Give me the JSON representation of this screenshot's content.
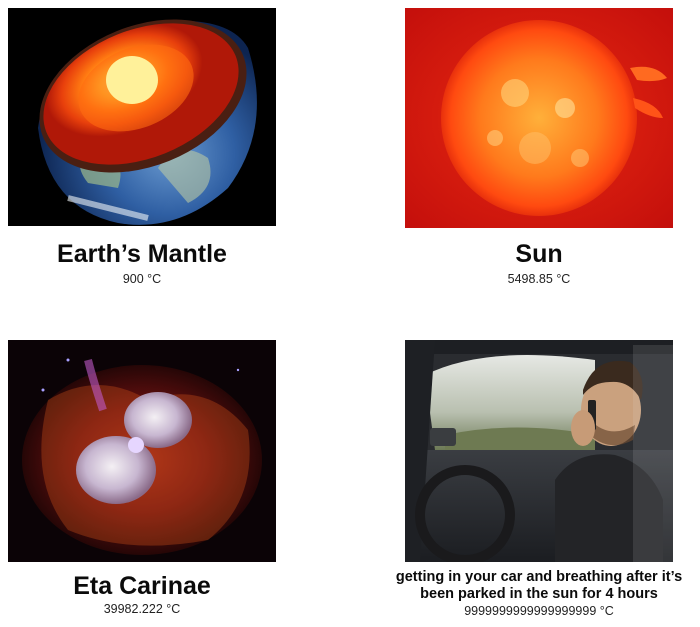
{
  "panels": [
    {
      "title": "Earth’s Mantle",
      "temperature": "900 °C"
    },
    {
      "title": "Sun",
      "temperature": "5498.85 °C"
    },
    {
      "title": "Eta Carinae",
      "temperature": "39982.222 °C"
    },
    {
      "title_line1": "getting in your car and breathing after it’s",
      "title_line2": "been parked in the sun for 4 hours",
      "temperature": "9999999999999999999 °C"
    }
  ]
}
